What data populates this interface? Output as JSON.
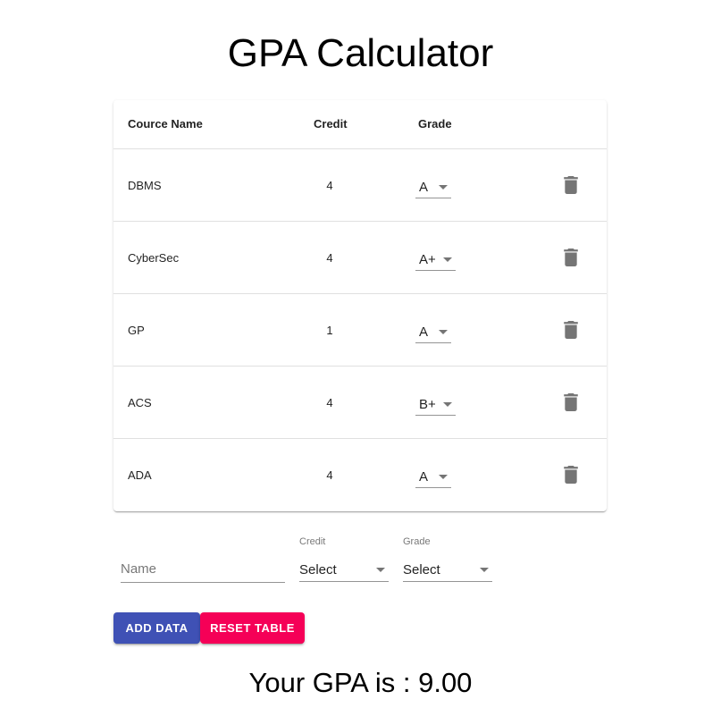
{
  "page": {
    "title": "GPA Calculator"
  },
  "table": {
    "headers": {
      "name": "Cource Name",
      "credit": "Credit",
      "grade": "Grade"
    },
    "rows": [
      {
        "name": "DBMS",
        "credit": "4",
        "grade": "A"
      },
      {
        "name": "CyberSec",
        "credit": "4",
        "grade": "A+"
      },
      {
        "name": "GP",
        "credit": "1",
        "grade": "A"
      },
      {
        "name": "ACS",
        "credit": "4",
        "grade": "B+"
      },
      {
        "name": "ADA",
        "credit": "4",
        "grade": "A"
      }
    ],
    "delete_icon": "trash-icon"
  },
  "form": {
    "name_placeholder": "Name",
    "credit_label": "Credit",
    "credit_value": "Select",
    "grade_label": "Grade",
    "grade_value": "Select"
  },
  "buttons": {
    "add": "ADD DATA",
    "reset": "RESET TABLE"
  },
  "result": {
    "text": "Your GPA is : 9.00"
  },
  "colors": {
    "primary": "#3f51b5",
    "secondary": "#f50057",
    "icon": "#757575"
  }
}
